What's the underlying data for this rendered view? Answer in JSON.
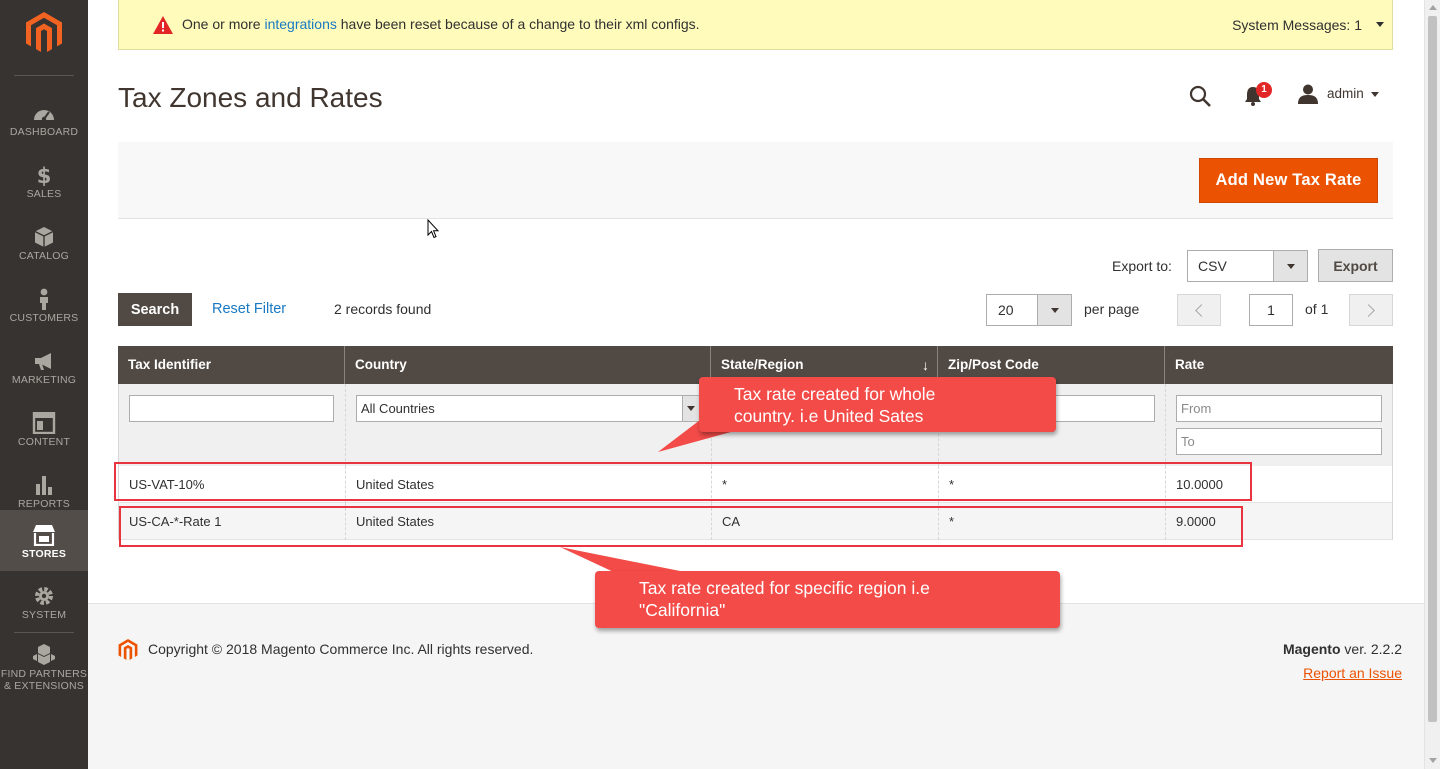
{
  "system_message": {
    "text_before": "One or more ",
    "link": "integrations",
    "text_after": " have been reset because of a change to their xml configs.",
    "system_messages": "System Messages: 1"
  },
  "sidebar": {
    "items": [
      {
        "label": "DASHBOARD",
        "icon": "dashboard-icon"
      },
      {
        "label": "SALES",
        "icon": "dollar-icon"
      },
      {
        "label": "CATALOG",
        "icon": "cube-icon"
      },
      {
        "label": "CUSTOMERS",
        "icon": "person-icon"
      },
      {
        "label": "MARKETING",
        "icon": "megaphone-icon"
      },
      {
        "label": "CONTENT",
        "icon": "layout-icon"
      },
      {
        "label": "REPORTS",
        "icon": "bar-chart-icon"
      },
      {
        "label": "STORES",
        "icon": "storefront-icon",
        "active": true
      },
      {
        "label": "SYSTEM",
        "icon": "gear-icon"
      },
      {
        "label": "FIND PARTNERS",
        "label2": "& EXTENSIONS",
        "icon": "boxes-icon"
      }
    ]
  },
  "header": {
    "title": "Tax Zones and Rates",
    "notification_count": "1",
    "username": "admin"
  },
  "actions": {
    "add_new": "Add New Tax Rate"
  },
  "export": {
    "label": "Export to:",
    "format": "CSV",
    "button": "Export"
  },
  "toolbar": {
    "search": "Search",
    "reset_filter": "Reset Filter",
    "records_found": "2 records found",
    "per_page_value": "20",
    "per_page_label": "per page",
    "current_page": "1",
    "total_pages": "of 1"
  },
  "grid": {
    "columns": [
      "Tax Identifier",
      "Country",
      "State/Region",
      "Zip/Post Code",
      "Rate"
    ],
    "filters": {
      "country": "All Countries",
      "rate_from": "From",
      "rate_to": "To"
    },
    "rows": [
      {
        "id": "US-VAT-10%",
        "country": "United States",
        "region": "*",
        "zip": "*",
        "rate": "10.0000"
      },
      {
        "id": "US-CA-*-Rate 1",
        "country": "United States",
        "region": "CA",
        "zip": "*",
        "rate": "9.0000"
      }
    ]
  },
  "annotations": {
    "callout1_line1": "Tax rate created for whole",
    "callout1_line2": "country. i.e United Sates",
    "callout2_line1": "Tax rate created for specific region i.e",
    "callout2_line2": "\"California\""
  },
  "footer": {
    "copyright": "Copyright © 2018 Magento Commerce Inc. All rights reserved.",
    "brand": "Magento",
    "version": " ver. 2.2.2",
    "report": "Report an Issue"
  },
  "colors": {
    "sidebar_bg": "#373330",
    "primary_button": "#eb5202",
    "grid_header": "#514943",
    "annotation": "#f24b48",
    "link": "#1979c3"
  }
}
